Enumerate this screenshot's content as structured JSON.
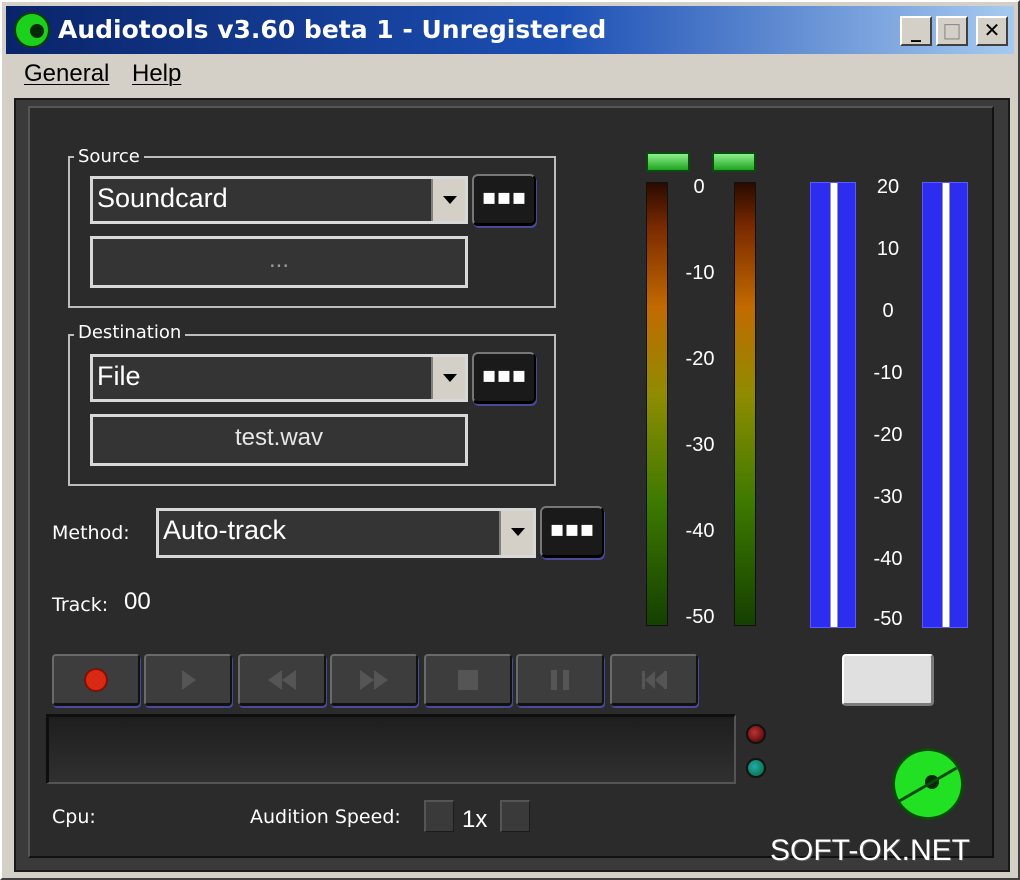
{
  "window": {
    "title": "Audiotools v3.60 beta 1 - Unregistered",
    "controls": {
      "minimize": "_",
      "maximize": "□",
      "close": "✕"
    }
  },
  "menu": {
    "general": "General",
    "help": "Help"
  },
  "source": {
    "group_label": "Source",
    "selected": "Soundcard",
    "browse_label": "▪▪▪",
    "info": "..."
  },
  "destination": {
    "group_label": "Destination",
    "selected": "File",
    "browse_label": "▪▪▪",
    "filename": "test.wav"
  },
  "method": {
    "label": "Method:",
    "selected": "Auto-track",
    "browse_label": "▪▪▪"
  },
  "track": {
    "label": "Track:",
    "value": "00"
  },
  "vu_scale": [
    "0",
    "-10",
    "-20",
    "-30",
    "-40",
    "-50"
  ],
  "gain_scale": [
    "20",
    "10",
    "0",
    "-10",
    "-20",
    "-30",
    "-40",
    "-50"
  ],
  "transport": [
    {
      "name": "record",
      "icon": "record-icon"
    },
    {
      "name": "play",
      "icon": "play-icon"
    },
    {
      "name": "rewind",
      "icon": "rewind-icon"
    },
    {
      "name": "fast-forward",
      "icon": "fast-forward-icon"
    },
    {
      "name": "stop",
      "icon": "stop-icon"
    },
    {
      "name": "pause",
      "icon": "pause-icon"
    },
    {
      "name": "skip",
      "icon": "skip-icon"
    }
  ],
  "status": {
    "cpu_label": "Cpu:",
    "audition_label": "Audition Speed:",
    "audition_value": "1x"
  },
  "watermark": "SOFT-OK.NET",
  "colors": {
    "record": "#d82a12",
    "meter_blue": "#2d2df0",
    "led_green": "#22e022"
  }
}
